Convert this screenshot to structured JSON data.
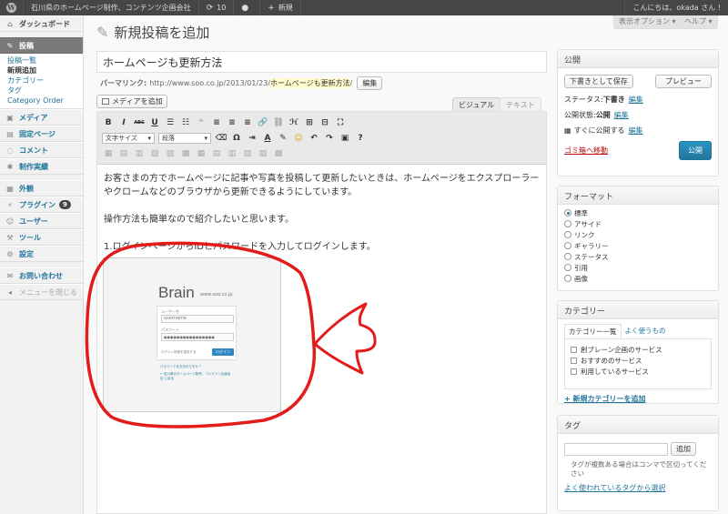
{
  "adminbar": {
    "site_name": "石川県のホームページ制作、コンテンツ企画会社",
    "updates": "10",
    "new_label": "新規",
    "greeting": "こんにちは、okada さん !"
  },
  "screen_options": "表示オプション ▾",
  "help": "ヘルプ ▾",
  "sidebar": {
    "items": [
      {
        "label": "ダッシュボード",
        "icon": "dashboard-icon"
      },
      {
        "label": "投稿",
        "icon": "pin-icon"
      },
      {
        "label": "メディア",
        "icon": "media-icon"
      },
      {
        "label": "固定ページ",
        "icon": "page-icon"
      },
      {
        "label": "コメント",
        "icon": "comment-icon"
      },
      {
        "label": "制作実績",
        "icon": "portfolio-icon"
      },
      {
        "label": "外観",
        "icon": "appearance-icon"
      },
      {
        "label": "プラグイン",
        "icon": "plugin-icon",
        "badge": "9"
      },
      {
        "label": "ユーザー",
        "icon": "users-icon"
      },
      {
        "label": "ツール",
        "icon": "tools-icon"
      },
      {
        "label": "設定",
        "icon": "settings-icon"
      },
      {
        "label": "お問い合わせ",
        "icon": "contact-icon"
      }
    ],
    "submenu": [
      "投稿一覧",
      "新規追加",
      "カテゴリー",
      "タグ",
      "Category Order"
    ],
    "collapse": "メニューを閉じる"
  },
  "page_title": "新規投稿を追加",
  "post_title": "ホームページも更新方法",
  "permalink": {
    "label": "パーマリンク:",
    "base": "http://www.soo.co.jp/2013/01/23/",
    "slug": "ホームページも更新方法",
    "tail": "/",
    "edit": "編集"
  },
  "media_button": "メディアを追加",
  "editor_tabs": {
    "visual": "ビジュアル",
    "text": "テキスト"
  },
  "toolbar": {
    "row1": [
      "B",
      "I",
      "ABC",
      "U",
      "☰",
      "☷",
      "❝",
      "≡",
      "≡",
      "≡",
      "🔗",
      "⛓",
      "ℋ",
      "⊞",
      "⊟",
      "⛶"
    ],
    "font_size": "文字サイズ",
    "format": "段落",
    "row2": [
      "⌫",
      "Ω",
      "⇥",
      "A",
      "✎",
      "☺",
      "↶",
      "↷",
      "▣",
      "?"
    ]
  },
  "content": {
    "p1": "お客さまの方でホームページに記事や写真を投稿して更新したいときは、ホームページをエクスプローラーやクロームなどのブラウザから更新できるようにしています。",
    "p2": "操作方法も簡単なので紹介したいと思います。",
    "p3": "1.ログインページからIDとパスワードを入力してログインします。"
  },
  "embed": {
    "brand": "Brain",
    "brand_url": "www.soo.co.jp",
    "user_label": "ユーザー名",
    "user_value": "username",
    "pass_label": "パスワード",
    "pass_value": "●●●●●●●●●●●●●●●●",
    "remember": "ログイン状態を保存する",
    "login": "ログイン",
    "lost": "パスワードをお忘れですか ?",
    "back": "← 石川県のホームページ制作、コンテンツ企画会社 に戻る"
  },
  "publish": {
    "title": "公開",
    "save_draft": "下書きとして保存",
    "preview": "プレビュー",
    "status_label": "ステータス:",
    "status_value": "下書き",
    "visibility_label": "公開状態:",
    "visibility_value": "公開",
    "schedule": "すぐに公開する",
    "edit": "編集",
    "trash": "ゴミ箱へ移動",
    "publish_btn": "公開"
  },
  "format": {
    "title": "フォーマット",
    "options": [
      "標準",
      "アサイド",
      "リンク",
      "ギャラリー",
      "ステータス",
      "引用",
      "画像"
    ],
    "selected": 0
  },
  "category": {
    "title": "カテゴリー",
    "tab_all": "カテゴリー一覧",
    "tab_popular": "よく使うもの",
    "items": [
      "創ブレーン企画のサービス",
      "おすすめのサービス",
      "利用しているサービス"
    ],
    "add_new": "+ 新規カテゴリーを追加"
  },
  "tags": {
    "title": "タグ",
    "add": "追加",
    "hint": "タグが複数ある場合はコンマで区切ってください",
    "popular": "よく使われているタグから選択"
  },
  "colors": {
    "accent": "#21759b",
    "annotation": "#e31b1b",
    "trash": "#bc0b0b"
  }
}
